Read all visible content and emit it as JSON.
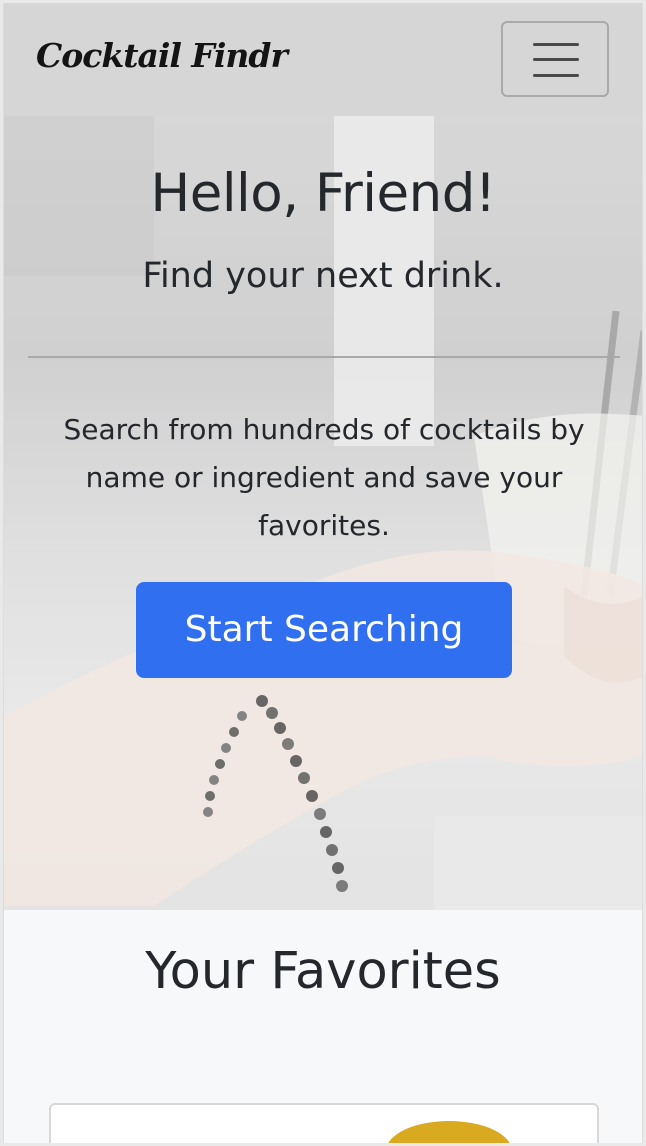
{
  "navbar": {
    "brand": "Cocktail Findr",
    "toggler_icon": "hamburger-menu-icon"
  },
  "hero": {
    "title": "Hello, Friend!",
    "subtitle": "Find your next drink.",
    "description": "Search from hundreds of cocktails by name or ingredient and save your favorites.",
    "cta_label": "Start Searching",
    "background_image": "photo-hand-holding-cocktail-glass-with-straws-bracelet"
  },
  "favorites": {
    "title": "Your Favorites"
  },
  "colors": {
    "navbar_bg": "#d6d6d6",
    "accent": "#2f6ff0",
    "text": "#24272b",
    "page_bg": "#f7f8fa"
  }
}
